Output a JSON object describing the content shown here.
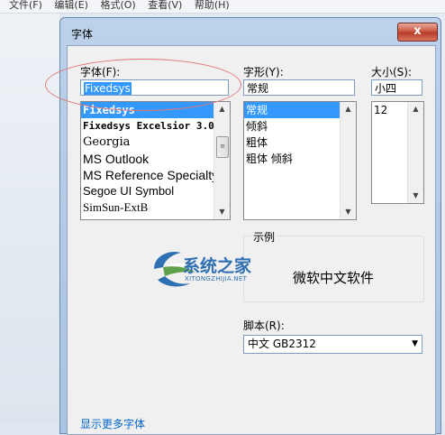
{
  "menu": [
    "文件(F)",
    "编辑(E)",
    "格式(O)",
    "查看(V)",
    "帮助(H)"
  ],
  "dialog": {
    "title": "字体",
    "close_label": "x",
    "font": {
      "label": "字体(F):",
      "value": "Fixedsys",
      "items": [
        "Fixedsys",
        "Fixedsys Excelsior 3.0",
        "Georgia",
        "MS Outlook",
        "MS Reference Specialty",
        "Segoe UI Symbol",
        "SimSun-ExtB"
      ],
      "selected_index": 0
    },
    "style": {
      "label": "字形(Y):",
      "value": "常规",
      "items": [
        "常规",
        "倾斜",
        "粗体",
        "粗体 倾斜"
      ],
      "selected_index": 0
    },
    "size": {
      "label": "大小(S):",
      "value": "小四",
      "items": [
        "12"
      ]
    },
    "sample": {
      "label": "示例",
      "text": "微软中文软件"
    },
    "script": {
      "label": "脚本(R):",
      "value": "中文 GB2312"
    },
    "more_fonts_link": "显示更多字体"
  },
  "watermark": {
    "brand": "系统之家",
    "url": "XITONGZHIJIA.NET",
    "colors": {
      "green": "#5fa14a",
      "blue": "#2f6fb3"
    }
  },
  "annotation": {
    "color": "#e37676"
  }
}
